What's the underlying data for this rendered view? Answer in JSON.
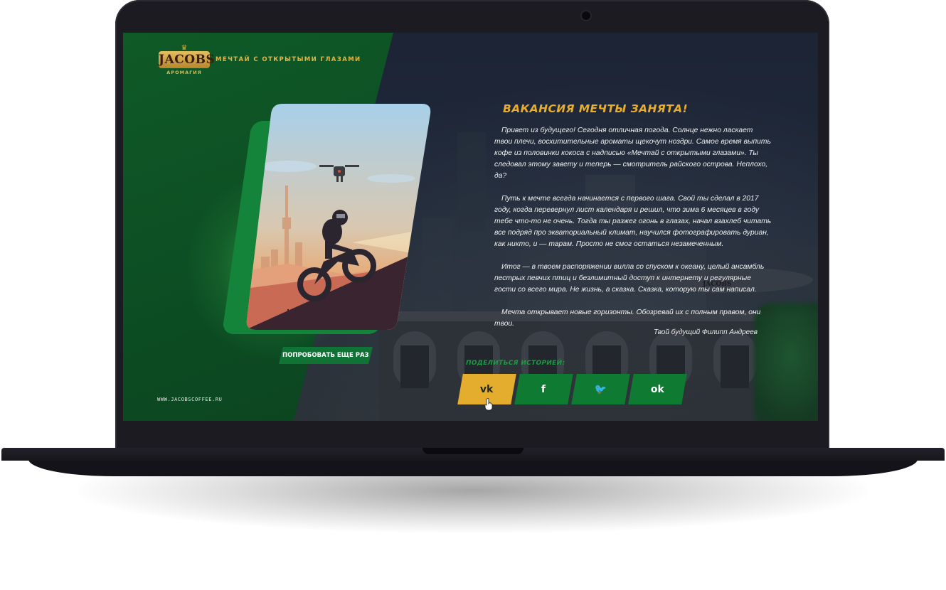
{
  "brand": {
    "logo_text": "JACOBS",
    "logo_sub": "АРОМАГИЯ",
    "tagline": "МЕЧТАЙ С ОТКРЫТЫМИ ГЛАЗАМИ"
  },
  "headline": "ВАКАНСИЯ МЕЧТЫ ЗАНЯТА!",
  "story": [
    "Привет из будущего! Сегодня отличная погода. Солнце нежно ласкает твои плечи, восхитительные ароматы щекочут ноздри. Самое время выпить кофе из половинки кокоса с надписью «Мечтай с открытыми глазами». Ты следовал этому завету и теперь — смотритель райского острова. Неплохо, да?",
    "Путь к мечте всегда начинается с первого шага. Свой ты сделал в 2017 году, когда перевернул лист календаря и решил, что зима 6 месяцев в году тебе что-то не очень. Тогда ты разжег огонь в глазах, начал взахлеб читать все подряд про экваториальный климат, научился фотографировать дуриан, как никто, и — тарам. Просто не смог остаться незамеченным.",
    "Итог — в твоем распоряжении вилла со спуском к океану, целый ансамбль пестрых певчих птиц и безлимитный доступ к интернету и регулярные гости со всего мира. Не жизнь, а сказка. Сказка, которую ты сам написал.",
    "Мечта открывает новые горизонты. Обозревай их с полным правом, они твои."
  ],
  "signature": "Твой будущий Филипп Андреев",
  "retry_label": "ПОПРОБОВАТЬ ЕЩЕ РАЗ",
  "footer_url": "WWW.JACOBSCOFFEE.RU",
  "share": {
    "label": "ПОДЕЛИТЬСЯ ИСТОРИЕЙ:",
    "buttons": [
      {
        "name": "vk",
        "glyph": "vk",
        "icon": "vk-icon",
        "active": true
      },
      {
        "name": "facebook",
        "glyph": "f",
        "icon": "facebook-icon",
        "active": false
      },
      {
        "name": "twitter",
        "glyph": "🐦",
        "icon": "twitter-icon",
        "active": false
      },
      {
        "name": "odnoklassniki",
        "glyph": "ok",
        "icon": "odnoklassniki-icon",
        "active": false
      }
    ]
  },
  "colors": {
    "green": "#0e7a32",
    "gold": "#e4ad2e",
    "night": "#1c2435"
  }
}
